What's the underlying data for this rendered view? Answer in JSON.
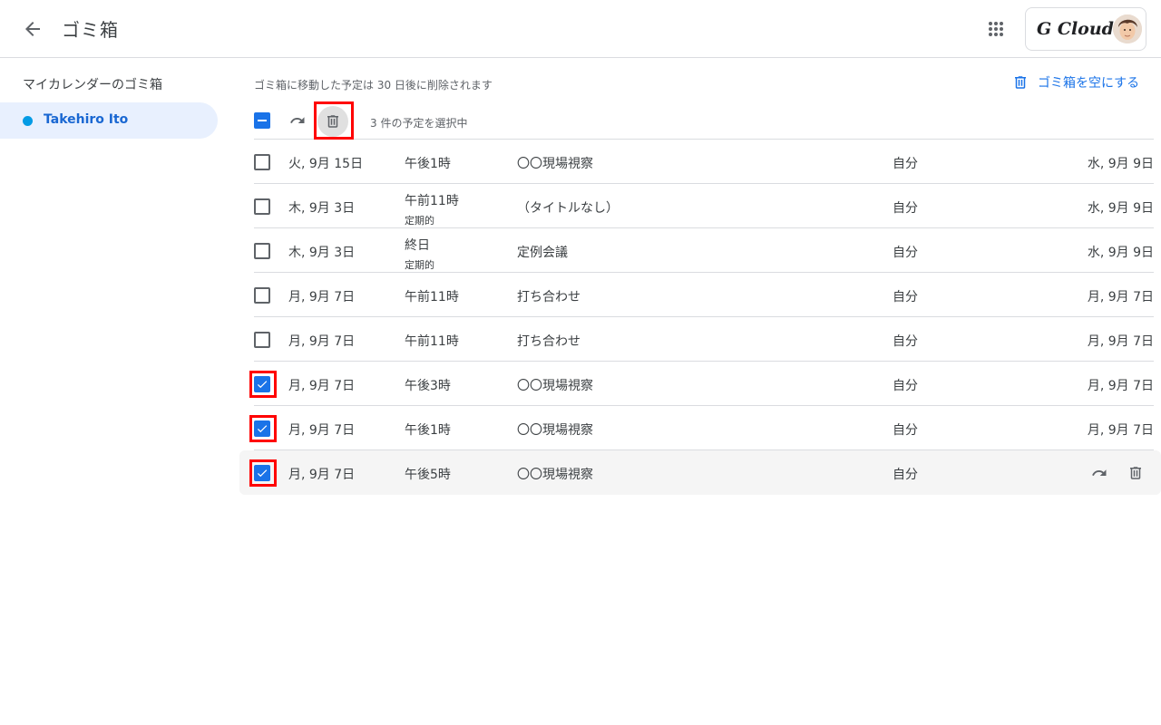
{
  "header": {
    "title": "ゴミ箱",
    "brand": "G Cloud"
  },
  "sidebar": {
    "heading": "マイカレンダーのゴミ箱",
    "items": [
      {
        "label": "Takehiro Ito",
        "color": "#039be5"
      }
    ]
  },
  "main": {
    "notice": "ゴミ箱に移動した予定は 30 日後に削除されます",
    "empty_trash_label": "ゴミ箱を空にする",
    "selection_count": "3 件の予定を選択中",
    "rows": [
      {
        "date": "火, 9月 15日",
        "time": "午後1時",
        "sub": "",
        "title": "〇〇現場視察",
        "owner": "自分",
        "deleted": "水, 9月 9日",
        "checked": false
      },
      {
        "date": "木, 9月 3日",
        "time": "午前11時",
        "sub": "定期的",
        "title": "（タイトルなし）",
        "owner": "自分",
        "deleted": "水, 9月 9日",
        "checked": false
      },
      {
        "date": "木, 9月 3日",
        "time": "終日",
        "sub": "定期的",
        "title": "定例会議",
        "owner": "自分",
        "deleted": "水, 9月 9日",
        "checked": false
      },
      {
        "date": "月, 9月 7日",
        "time": "午前11時",
        "sub": "",
        "title": "打ち合わせ",
        "owner": "自分",
        "deleted": "月, 9月 7日",
        "checked": false
      },
      {
        "date": "月, 9月 7日",
        "time": "午前11時",
        "sub": "",
        "title": "打ち合わせ",
        "owner": "自分",
        "deleted": "月, 9月 7日",
        "checked": false
      },
      {
        "date": "月, 9月 7日",
        "time": "午後3時",
        "sub": "",
        "title": "〇〇現場視察",
        "owner": "自分",
        "deleted": "月, 9月 7日",
        "checked": true
      },
      {
        "date": "月, 9月 7日",
        "time": "午後1時",
        "sub": "",
        "title": "〇〇現場視察",
        "owner": "自分",
        "deleted": "月, 9月 7日",
        "checked": true
      },
      {
        "date": "月, 9月 7日",
        "time": "午後5時",
        "sub": "",
        "title": "〇〇現場視察",
        "owner": "自分",
        "deleted": "",
        "checked": true
      }
    ]
  },
  "colors": {
    "accent": "#1a73e8",
    "highlight": "#ff0000"
  },
  "icons": [
    "back-arrow-icon",
    "apps-grid-icon",
    "trash-icon",
    "restore-icon",
    "check-icon"
  ]
}
